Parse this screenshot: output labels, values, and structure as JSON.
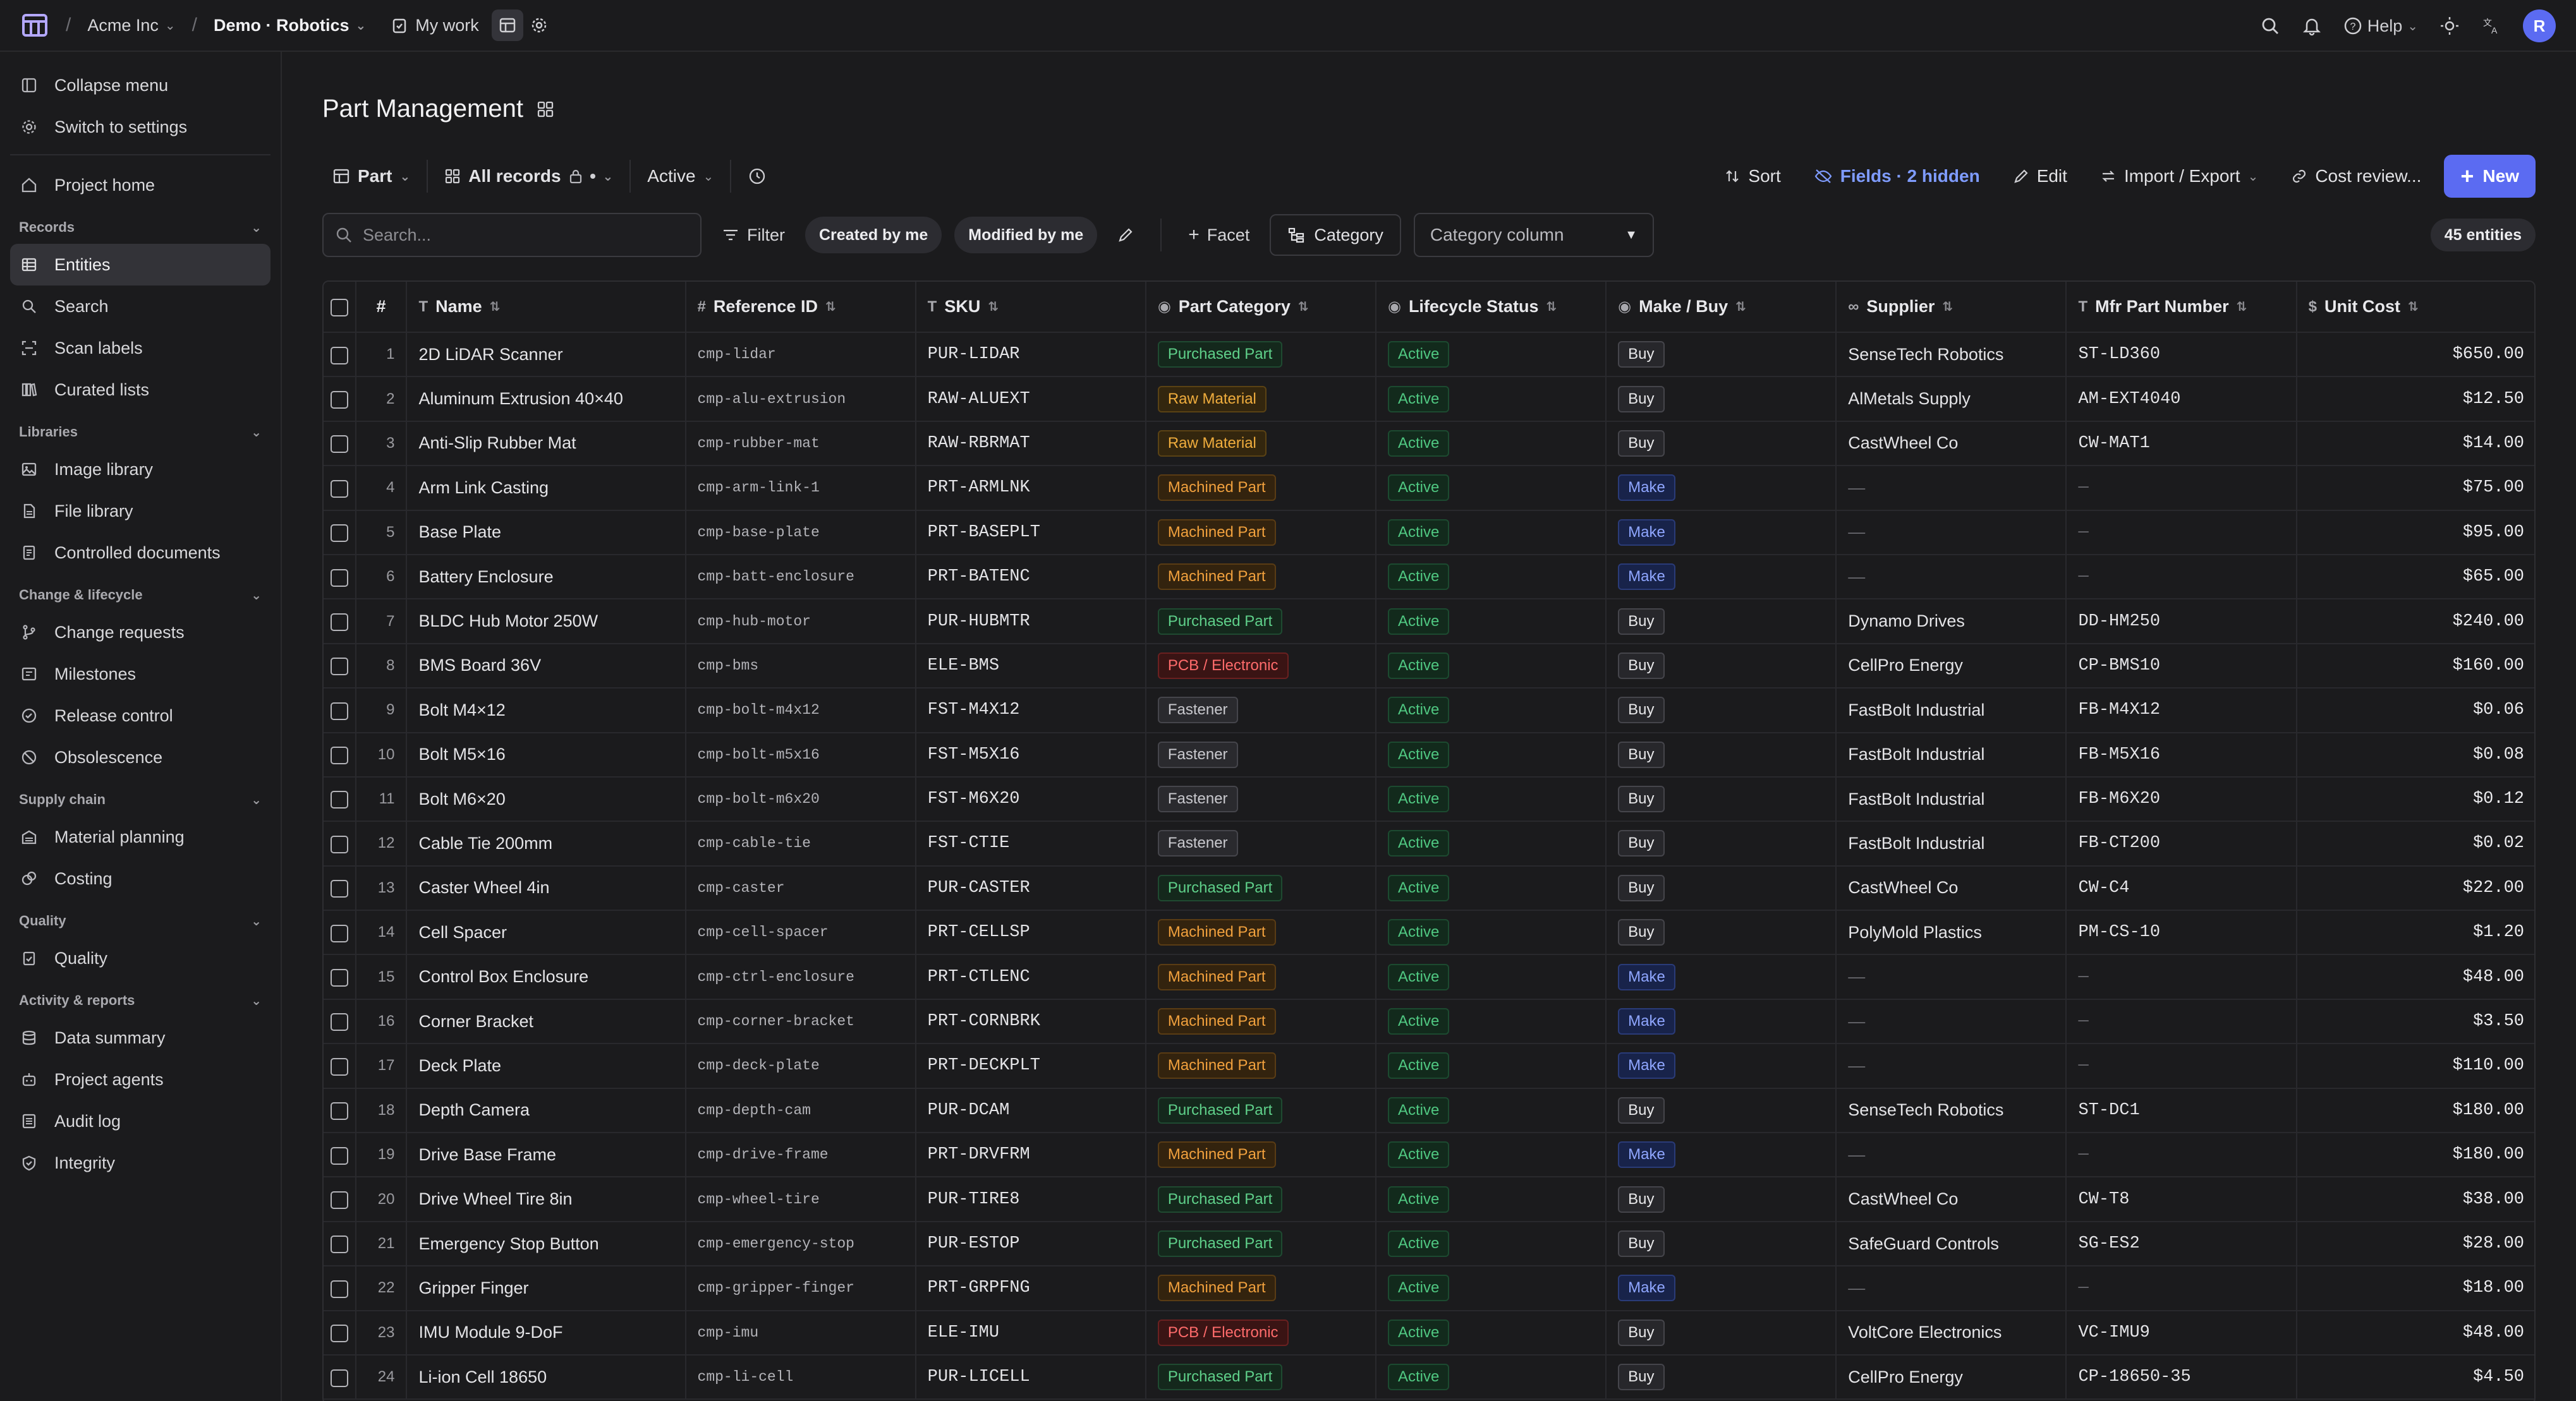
{
  "topbar": {
    "org": "Acme Inc",
    "project": "Demo · Robotics",
    "my_work": "My work",
    "help": "Help",
    "avatar_initial": "R"
  },
  "sidebar": {
    "collapse": "Collapse menu",
    "switch_settings": "Switch to settings",
    "project_home": "Project home",
    "sections": {
      "records": "Records",
      "libraries": "Libraries",
      "change": "Change & lifecycle",
      "supply": "Supply chain",
      "quality": "Quality",
      "activity": "Activity & reports"
    },
    "records_items": [
      "Entities",
      "Search",
      "Scan labels",
      "Curated lists"
    ],
    "libraries_items": [
      "Image library",
      "File library",
      "Controlled documents"
    ],
    "change_items": [
      "Change requests",
      "Milestones",
      "Release control",
      "Obsolescence"
    ],
    "supply_items": [
      "Material planning",
      "Costing"
    ],
    "quality_items": [
      "Quality"
    ],
    "activity_items": [
      "Data summary",
      "Project agents",
      "Audit log",
      "Integrity"
    ]
  },
  "page": {
    "title": "Part Management"
  },
  "toolbar": {
    "entity_type": "Part",
    "view": "All records",
    "status": "Active",
    "sort": "Sort",
    "fields": "Fields · 2 hidden",
    "edit": "Edit",
    "import_export": "Import / Export",
    "cost_review": "Cost review...",
    "new": "New"
  },
  "filterbar": {
    "search_placeholder": "Search...",
    "filter": "Filter",
    "chip_created": "Created by me",
    "chip_modified": "Modified by me",
    "facet": "Facet",
    "category": "Category",
    "category_column": "Category column",
    "count": "45 entities"
  },
  "table": {
    "columns": [
      "#",
      "Name",
      "Reference ID",
      "SKU",
      "Part Category",
      "Lifecycle Status",
      "Make / Buy",
      "Supplier",
      "Mfr Part Number",
      "Unit Cost"
    ],
    "rows": [
      {
        "n": "1",
        "name": "2D LiDAR Scanner",
        "ref": "cmp-lidar",
        "sku": "PUR-LIDAR",
        "cat": "Purchased Part",
        "status": "Active",
        "mb": "Buy",
        "supplier": "SenseTech Robotics",
        "mpn": "ST-LD360",
        "cost": "$650.00"
      },
      {
        "n": "2",
        "name": "Aluminum Extrusion 40×40",
        "ref": "cmp-alu-extrusion",
        "sku": "RAW-ALUEXT",
        "cat": "Raw Material",
        "status": "Active",
        "mb": "Buy",
        "supplier": "AlMetals Supply",
        "mpn": "AM-EXT4040",
        "cost": "$12.50"
      },
      {
        "n": "3",
        "name": "Anti-Slip Rubber Mat",
        "ref": "cmp-rubber-mat",
        "sku": "RAW-RBRMAT",
        "cat": "Raw Material",
        "status": "Active",
        "mb": "Buy",
        "supplier": "CastWheel Co",
        "mpn": "CW-MAT1",
        "cost": "$14.00"
      },
      {
        "n": "4",
        "name": "Arm Link Casting",
        "ref": "cmp-arm-link-1",
        "sku": "PRT-ARMLNK",
        "cat": "Machined Part",
        "status": "Active",
        "mb": "Make",
        "supplier": "—",
        "mpn": "—",
        "cost": "$75.00"
      },
      {
        "n": "5",
        "name": "Base Plate",
        "ref": "cmp-base-plate",
        "sku": "PRT-BASEPLT",
        "cat": "Machined Part",
        "status": "Active",
        "mb": "Make",
        "supplier": "—",
        "mpn": "—",
        "cost": "$95.00"
      },
      {
        "n": "6",
        "name": "Battery Enclosure",
        "ref": "cmp-batt-enclosure",
        "sku": "PRT-BATENC",
        "cat": "Machined Part",
        "status": "Active",
        "mb": "Make",
        "supplier": "—",
        "mpn": "—",
        "cost": "$65.00"
      },
      {
        "n": "7",
        "name": "BLDC Hub Motor 250W",
        "ref": "cmp-hub-motor",
        "sku": "PUR-HUBMTR",
        "cat": "Purchased Part",
        "status": "Active",
        "mb": "Buy",
        "supplier": "Dynamo Drives",
        "mpn": "DD-HM250",
        "cost": "$240.00"
      },
      {
        "n": "8",
        "name": "BMS Board 36V",
        "ref": "cmp-bms",
        "sku": "ELE-BMS",
        "cat": "PCB / Electronic",
        "status": "Active",
        "mb": "Buy",
        "supplier": "CellPro Energy",
        "mpn": "CP-BMS10",
        "cost": "$160.00"
      },
      {
        "n": "9",
        "name": "Bolt M4×12",
        "ref": "cmp-bolt-m4x12",
        "sku": "FST-M4X12",
        "cat": "Fastener",
        "status": "Active",
        "mb": "Buy",
        "supplier": "FastBolt Industrial",
        "mpn": "FB-M4X12",
        "cost": "$0.06"
      },
      {
        "n": "10",
        "name": "Bolt M5×16",
        "ref": "cmp-bolt-m5x16",
        "sku": "FST-M5X16",
        "cat": "Fastener",
        "status": "Active",
        "mb": "Buy",
        "supplier": "FastBolt Industrial",
        "mpn": "FB-M5X16",
        "cost": "$0.08"
      },
      {
        "n": "11",
        "name": "Bolt M6×20",
        "ref": "cmp-bolt-m6x20",
        "sku": "FST-M6X20",
        "cat": "Fastener",
        "status": "Active",
        "mb": "Buy",
        "supplier": "FastBolt Industrial",
        "mpn": "FB-M6X20",
        "cost": "$0.12"
      },
      {
        "n": "12",
        "name": "Cable Tie 200mm",
        "ref": "cmp-cable-tie",
        "sku": "FST-CTIE",
        "cat": "Fastener",
        "status": "Active",
        "mb": "Buy",
        "supplier": "FastBolt Industrial",
        "mpn": "FB-CT200",
        "cost": "$0.02"
      },
      {
        "n": "13",
        "name": "Caster Wheel 4in",
        "ref": "cmp-caster",
        "sku": "PUR-CASTER",
        "cat": "Purchased Part",
        "status": "Active",
        "mb": "Buy",
        "supplier": "CastWheel Co",
        "mpn": "CW-C4",
        "cost": "$22.00"
      },
      {
        "n": "14",
        "name": "Cell Spacer",
        "ref": "cmp-cell-spacer",
        "sku": "PRT-CELLSP",
        "cat": "Machined Part",
        "status": "Active",
        "mb": "Buy",
        "supplier": "PolyMold Plastics",
        "mpn": "PM-CS-10",
        "cost": "$1.20"
      },
      {
        "n": "15",
        "name": "Control Box Enclosure",
        "ref": "cmp-ctrl-enclosure",
        "sku": "PRT-CTLENC",
        "cat": "Machined Part",
        "status": "Active",
        "mb": "Make",
        "supplier": "—",
        "mpn": "—",
        "cost": "$48.00"
      },
      {
        "n": "16",
        "name": "Corner Bracket",
        "ref": "cmp-corner-bracket",
        "sku": "PRT-CORNBRK",
        "cat": "Machined Part",
        "status": "Active",
        "mb": "Make",
        "supplier": "—",
        "mpn": "—",
        "cost": "$3.50"
      },
      {
        "n": "17",
        "name": "Deck Plate",
        "ref": "cmp-deck-plate",
        "sku": "PRT-DECKPLT",
        "cat": "Machined Part",
        "status": "Active",
        "mb": "Make",
        "supplier": "—",
        "mpn": "—",
        "cost": "$110.00"
      },
      {
        "n": "18",
        "name": "Depth Camera",
        "ref": "cmp-depth-cam",
        "sku": "PUR-DCAM",
        "cat": "Purchased Part",
        "status": "Active",
        "mb": "Buy",
        "supplier": "SenseTech Robotics",
        "mpn": "ST-DC1",
        "cost": "$180.00"
      },
      {
        "n": "19",
        "name": "Drive Base Frame",
        "ref": "cmp-drive-frame",
        "sku": "PRT-DRVFRM",
        "cat": "Machined Part",
        "status": "Active",
        "mb": "Make",
        "supplier": "—",
        "mpn": "—",
        "cost": "$180.00"
      },
      {
        "n": "20",
        "name": "Drive Wheel Tire 8in",
        "ref": "cmp-wheel-tire",
        "sku": "PUR-TIRE8",
        "cat": "Purchased Part",
        "status": "Active",
        "mb": "Buy",
        "supplier": "CastWheel Co",
        "mpn": "CW-T8",
        "cost": "$38.00"
      },
      {
        "n": "21",
        "name": "Emergency Stop Button",
        "ref": "cmp-emergency-stop",
        "sku": "PUR-ESTOP",
        "cat": "Purchased Part",
        "status": "Active",
        "mb": "Buy",
        "supplier": "SafeGuard Controls",
        "mpn": "SG-ES2",
        "cost": "$28.00"
      },
      {
        "n": "22",
        "name": "Gripper Finger",
        "ref": "cmp-gripper-finger",
        "sku": "PRT-GRPFNG",
        "cat": "Machined Part",
        "status": "Active",
        "mb": "Make",
        "supplier": "—",
        "mpn": "—",
        "cost": "$18.00"
      },
      {
        "n": "23",
        "name": "IMU Module 9-DoF",
        "ref": "cmp-imu",
        "sku": "ELE-IMU",
        "cat": "PCB / Electronic",
        "status": "Active",
        "mb": "Buy",
        "supplier": "VoltCore Electronics",
        "mpn": "VC-IMU9",
        "cost": "$48.00"
      },
      {
        "n": "24",
        "name": "Li-ion Cell 18650",
        "ref": "cmp-li-cell",
        "sku": "PUR-LICELL",
        "cat": "Purchased Part",
        "status": "Active",
        "mb": "Buy",
        "supplier": "CellPro Energy",
        "mpn": "CP-18650-35",
        "cost": "$4.50"
      }
    ]
  },
  "colors": {
    "accent": "#5b6bf2",
    "background": "#1b1b1d"
  }
}
